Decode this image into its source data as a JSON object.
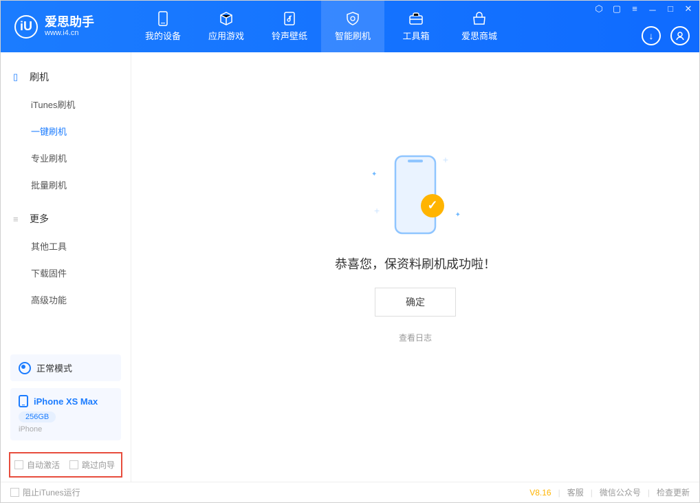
{
  "app": {
    "logo_letter": "iU",
    "title": "爱思助手",
    "subtitle": "www.i4.cn"
  },
  "nav": {
    "tabs": [
      {
        "label": "我的设备",
        "icon": "device"
      },
      {
        "label": "应用游戏",
        "icon": "cube"
      },
      {
        "label": "铃声壁纸",
        "icon": "music"
      },
      {
        "label": "智能刷机",
        "icon": "shield"
      },
      {
        "label": "工具箱",
        "icon": "toolbox"
      },
      {
        "label": "爱思商城",
        "icon": "shop"
      }
    ],
    "active_index": 3
  },
  "sidebar": {
    "section1_title": "刷机",
    "section1_items": [
      "iTunes刷机",
      "一键刷机",
      "专业刷机",
      "批量刷机"
    ],
    "section1_active": 1,
    "section2_title": "更多",
    "section2_items": [
      "其他工具",
      "下载固件",
      "高级功能"
    ]
  },
  "mode": {
    "label": "正常模式"
  },
  "device": {
    "name": "iPhone XS Max",
    "storage": "256GB",
    "type": "iPhone"
  },
  "checkboxes": {
    "auto_activate": "自动激活",
    "skip_guide": "跳过向导"
  },
  "main": {
    "success_message": "恭喜您，保资料刷机成功啦！",
    "confirm_button": "确定",
    "view_log": "查看日志"
  },
  "footer": {
    "block_itunes": "阻止iTunes运行",
    "version": "V8.16",
    "link1": "客服",
    "link2": "微信公众号",
    "link3": "检查更新"
  }
}
